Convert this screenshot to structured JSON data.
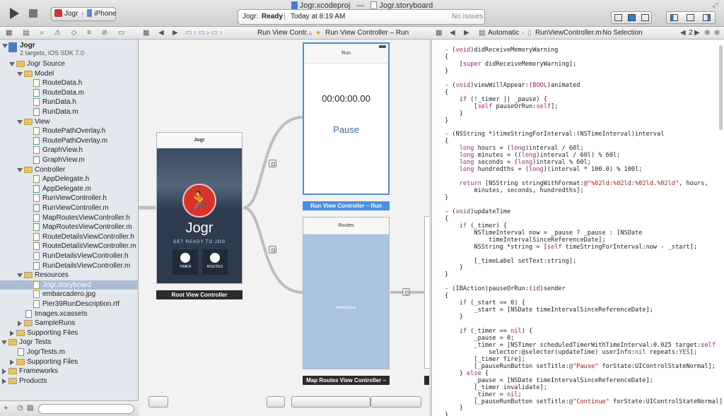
{
  "window": {
    "title": "Jogr.xcodeproj",
    "title_sep": "—",
    "storyboard": "Jogr.storyboard"
  },
  "toolbar": {
    "scheme": {
      "target": "Jogr",
      "device": "iPhone"
    },
    "activity": {
      "status_project": "Jogr:",
      "status": "Ready",
      "sep": "|",
      "time": "Today at 8:19 AM",
      "issues": "No Issues"
    }
  },
  "jumpbar_left": [
    "Run View Contr...",
    "Run View Controller – Run"
  ],
  "jumpbar_right": {
    "mode": "Automatic",
    "file": "RunViewController.m",
    "selection": "No Selection",
    "count": "2"
  },
  "navigator": {
    "project": "Jogr",
    "project_sub": "2 targets, iOS SDK 7.0",
    "items": [
      {
        "label": "Jogr Source",
        "type": "folder",
        "level": 1,
        "open": true
      },
      {
        "label": "Model",
        "type": "folder",
        "level": 2,
        "open": true
      },
      {
        "label": "RouteData.h",
        "type": "h",
        "level": 3
      },
      {
        "label": "RouteData.m",
        "type": "m",
        "level": 3
      },
      {
        "label": "RunData.h",
        "type": "h",
        "level": 3
      },
      {
        "label": "RunData.m",
        "type": "m",
        "level": 3
      },
      {
        "label": "View",
        "type": "folder",
        "level": 2,
        "open": true
      },
      {
        "label": "RoutePathOverlay.h",
        "type": "h",
        "level": 3
      },
      {
        "label": "RoutePathOverlay.m",
        "type": "m",
        "level": 3
      },
      {
        "label": "GraphView.h",
        "type": "h",
        "level": 3
      },
      {
        "label": "GraphView.m",
        "type": "m",
        "level": 3
      },
      {
        "label": "Controller",
        "type": "folder",
        "level": 2,
        "open": true
      },
      {
        "label": "AppDelegate.h",
        "type": "h",
        "level": 3
      },
      {
        "label": "AppDelegate.m",
        "type": "m",
        "level": 3
      },
      {
        "label": "RunViewController.h",
        "type": "h",
        "level": 3
      },
      {
        "label": "RunViewController.m",
        "type": "m",
        "level": 3
      },
      {
        "label": "MapRoutesViewController.h",
        "type": "h",
        "level": 3
      },
      {
        "label": "MapRoutesViewController.m",
        "type": "m",
        "level": 3
      },
      {
        "label": "RouteDetailsViewController.h",
        "type": "h",
        "level": 3
      },
      {
        "label": "RouteDetailsViewController.m",
        "type": "m",
        "level": 3
      },
      {
        "label": "RunDetailsViewController.h",
        "type": "h",
        "level": 3
      },
      {
        "label": "RunDetailsViewController.m",
        "type": "m",
        "level": 3
      },
      {
        "label": "Resources",
        "type": "folder",
        "level": 2,
        "open": true
      },
      {
        "label": "Jogr.storyboard",
        "type": "sb",
        "level": 3,
        "selected": true
      },
      {
        "label": "embarcadero.jpg",
        "type": "img",
        "level": 3
      },
      {
        "label": "Pier39RunDescription.rtf",
        "type": "doc",
        "level": 3
      },
      {
        "label": "Images.xcassets",
        "type": "assets",
        "level": 2
      },
      {
        "label": "SampleRuns",
        "type": "folder",
        "level": 2
      },
      {
        "label": "Supporting Files",
        "type": "folder",
        "level": 1
      },
      {
        "label": "Jogr Tests",
        "type": "folder",
        "level": 0,
        "open": true
      },
      {
        "label": "JogrTests.m",
        "type": "m",
        "level": 1
      },
      {
        "label": "Supporting Files",
        "type": "folder",
        "level": 1
      },
      {
        "label": "Frameworks",
        "type": "folder",
        "level": 0
      },
      {
        "label": "Products",
        "type": "folder",
        "level": 0
      }
    ]
  },
  "storyboard": {
    "root": {
      "nav_title": "Jogr",
      "brand": "Jogr",
      "tagline": "GET READY TO JOG",
      "btn_timer": "TIMER",
      "btn_routes": "ROUTES",
      "label": "Root View Controller"
    },
    "run": {
      "nav_title": "Run",
      "time": "00:00:00.00",
      "pause": "Pause",
      "label": "Run View Controller – Run"
    },
    "routes": {
      "nav_title": "Routes",
      "map": "MKMapView",
      "label": "Map Routes View Controller –"
    }
  },
  "code_lines": [
    "- (void)didReceiveMemoryWarning",
    "{",
    "    [super didReceiveMemoryWarning];",
    "}",
    "",
    "- (void)viewWillAppear:(BOOL)animated",
    "{",
    "    if (!_timer || _pause) {",
    "        [self pauseOrRun:self];",
    "    }",
    "}",
    "",
    "- (NSString *)timeStringForInterval:(NSTimeInterval)interval",
    "{",
    "    long hours = (long)interval / 60l;",
    "    long minutes = ((long)interval / 60l) % 60l;",
    "    long seconds = (long)interval % 60l;",
    "    long hundredths = (long)(interval * 100.0) % 100l;",
    "",
    "    return [NSString stringWithFormat:@\"%02ld:%02ld:%02ld.%02ld\", hours,",
    "        minutes, seconds, hundredths];",
    "}",
    "",
    "- (void)updateTime",
    "{",
    "    if (_timer) {",
    "        NSTimeInterval now = _pause ? _pause : [NSDate",
    "            timeIntervalSinceReferenceDate];",
    "        NSString *string = [self timeStringForInterval:now - _start];",
    "",
    "        [_timeLabel setText:string];",
    "    }",
    "}",
    "",
    "- (IBAction)pauseOrRun:(id)sender",
    "{",
    "    if (_start == 0) {",
    "        _start = [NSDate timeIntervalSinceReferenceDate];",
    "    }",
    "",
    "    if (_timer == nil) {",
    "        _pause = 0;",
    "        _timer = [NSTimer scheduledTimerWithTimeInterval:0.025 target:self",
    "            selector:@selector(updateTime) userInfo:nil repeats:YES];",
    "        [_timer fire];",
    "        [_pauseRunButton setTitle:@\"Pause\" forState:UIControlStateNormal];",
    "    } else {",
    "        _pause = [NSDate timeIntervalSinceReferenceDate];",
    "        [_timer invalidate];",
    "        _timer = nil;",
    "        [_pauseRunButton setTitle:@\"Continue\" forState:UIControlStateNormal];",
    "    }",
    "}"
  ],
  "colors": {
    "accent_red": "#d9322a",
    "selection_blue": "#4a90e2",
    "keyword": "#b0217f",
    "string": "#c41a16"
  }
}
